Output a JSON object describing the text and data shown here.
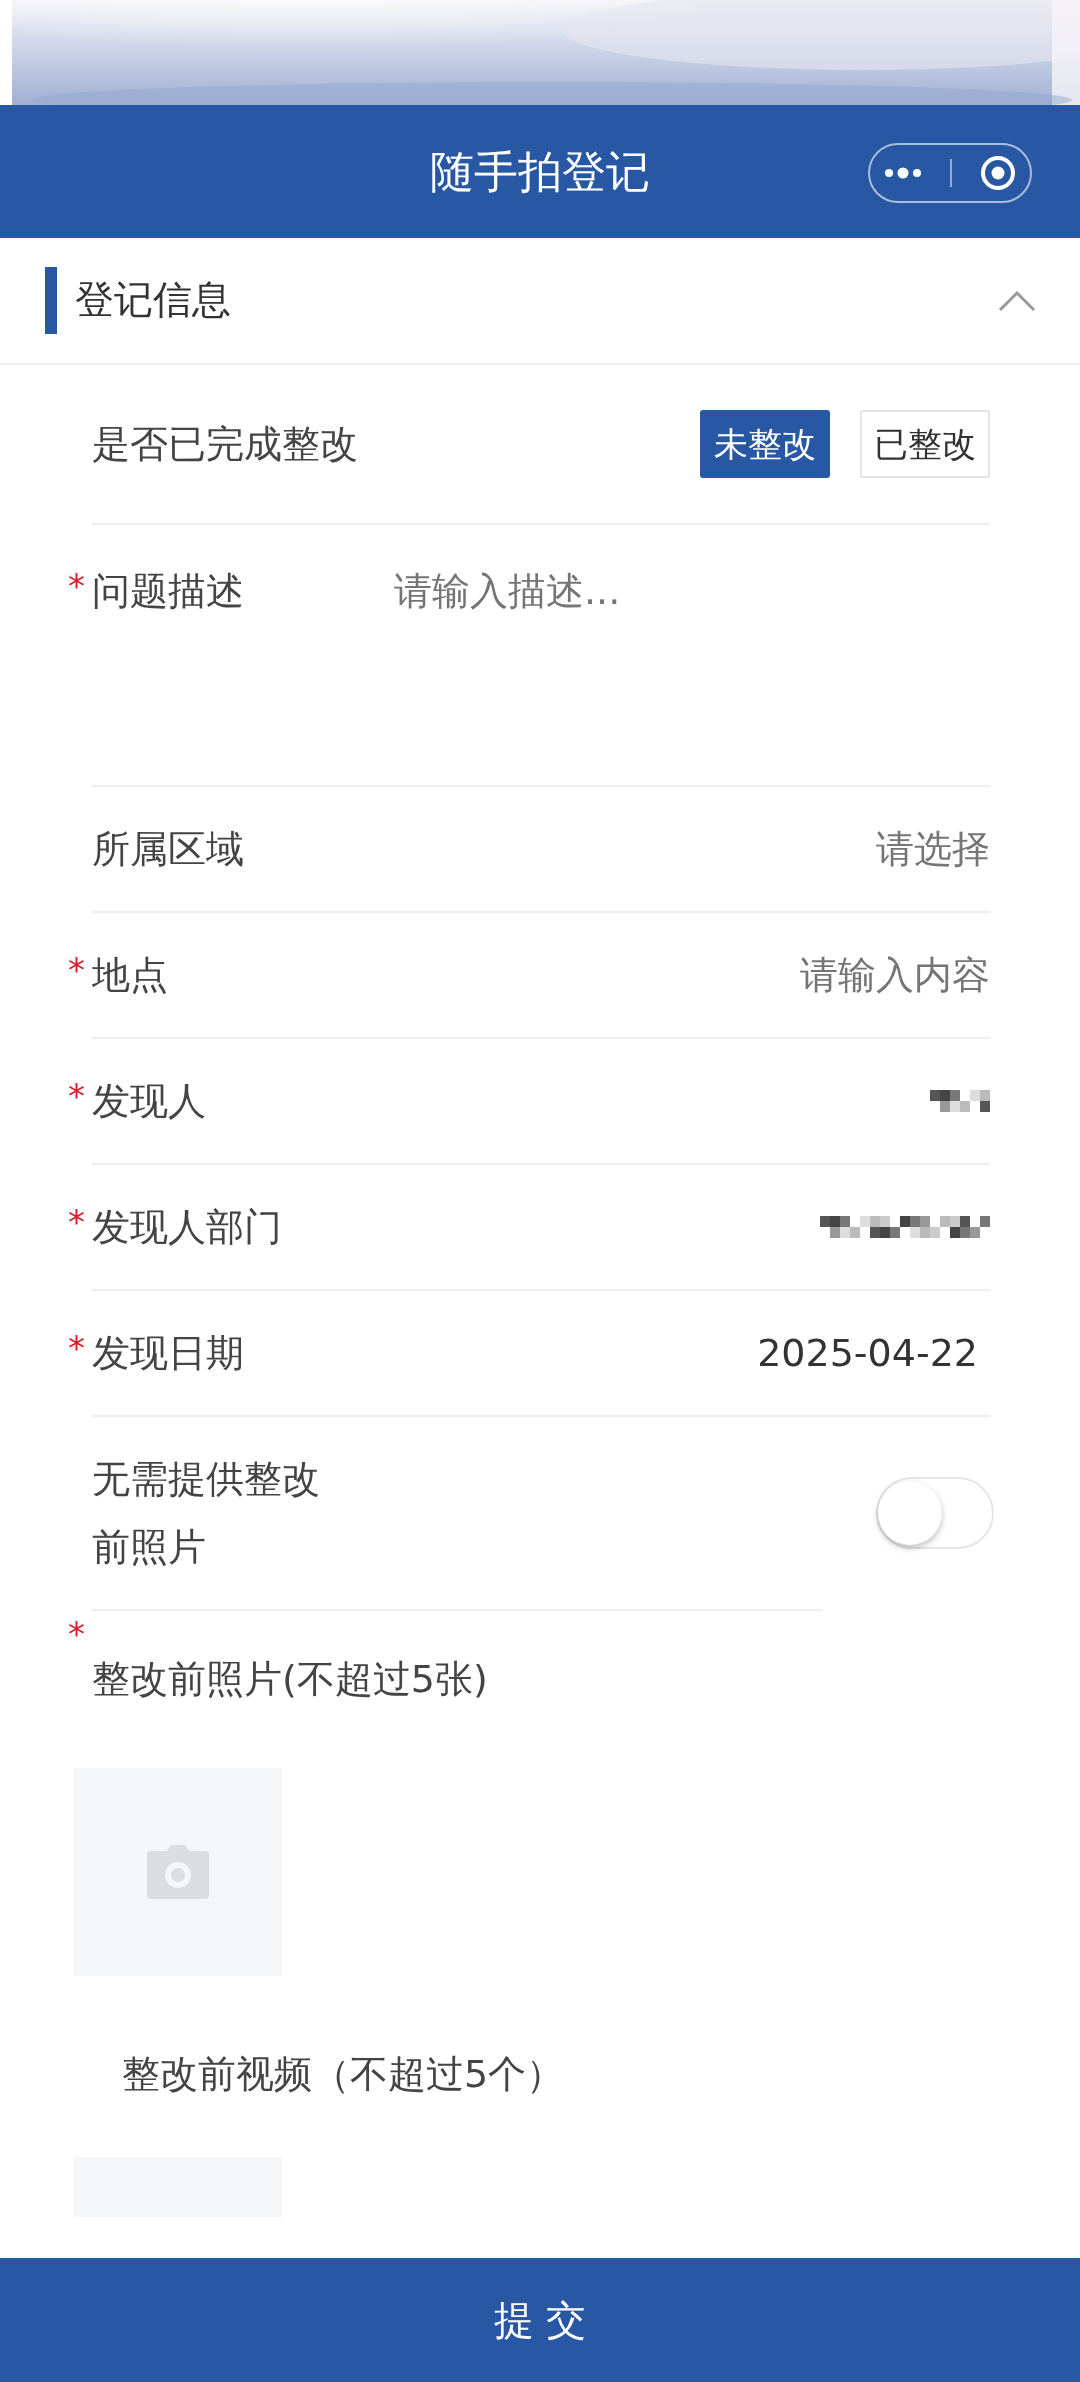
{
  "header": {
    "title": "随手拍登记"
  },
  "section": {
    "title": "登记信息",
    "expanded": true
  },
  "required_mark": "*",
  "rectified": {
    "label": "是否已完成整改",
    "options": [
      {
        "label": "未整改",
        "selected": true
      },
      {
        "label": "已整改",
        "selected": false
      }
    ]
  },
  "fields": [
    {
      "kind": "textarea",
      "label": "问题描述",
      "required": true,
      "placeholder": "请输入描述..."
    },
    {
      "kind": "select",
      "label": "所属区域",
      "required": false,
      "placeholder": "请选择"
    },
    {
      "kind": "input",
      "label": "地点",
      "required": true,
      "placeholder": "请输入内容"
    },
    {
      "kind": "redacted",
      "label": "发现人",
      "required": true
    },
    {
      "kind": "redacted",
      "label": "发现人部门",
      "required": true
    },
    {
      "kind": "value",
      "label": "发现日期",
      "required": true,
      "value": "2025-04-22"
    },
    {
      "kind": "switch",
      "label": "无需提供整改前照片",
      "required": false,
      "on": false
    }
  ],
  "uploads": [
    {
      "label": "整改前照片(不超过5张)",
      "required": true
    },
    {
      "label": "整改前视频（不超过5个）",
      "required": false
    }
  ],
  "submit": {
    "label": "提 交"
  }
}
